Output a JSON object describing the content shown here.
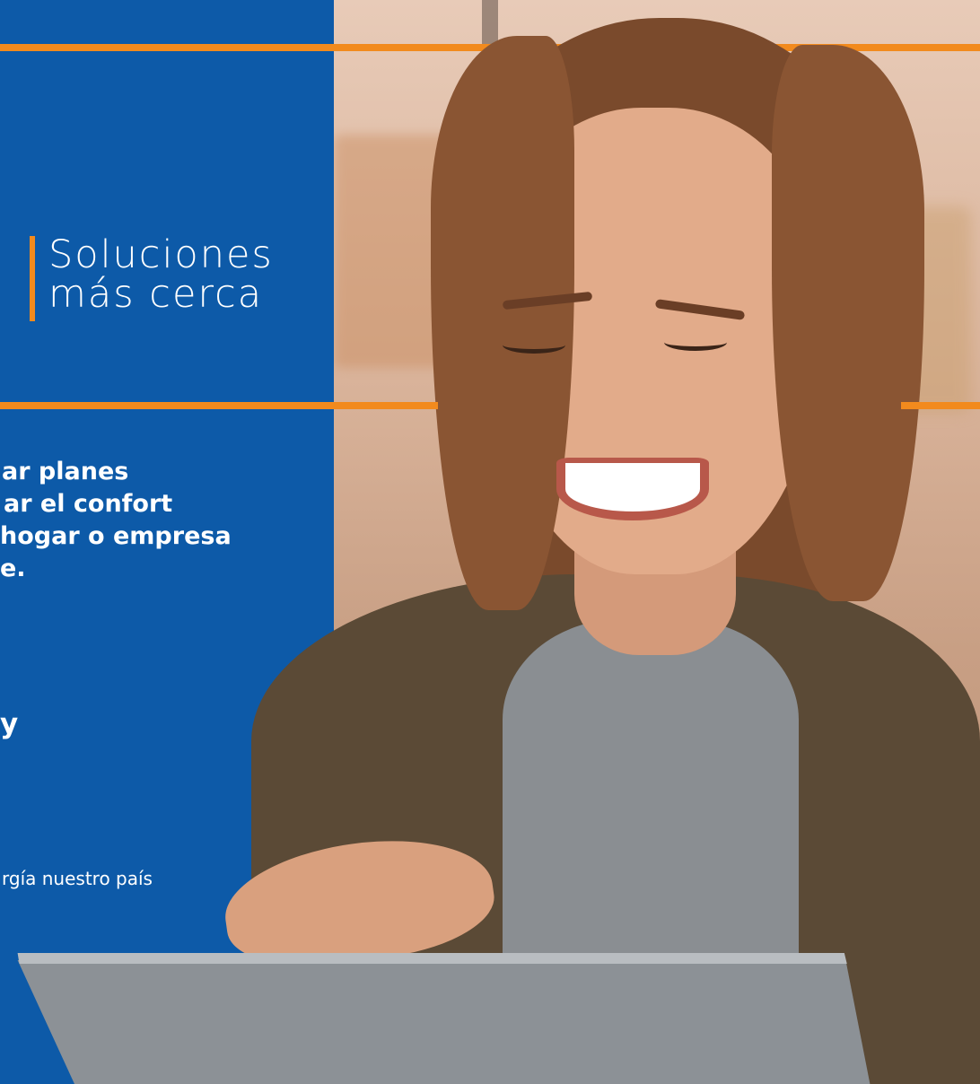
{
  "panel": {
    "background_color": "#0d5aa8",
    "accent_color": "#f28a1d"
  },
  "headline": {
    "line1": "Soluciones",
    "line2": "más cerca"
  },
  "body": {
    "line1": "ar planes",
    "line2": "ar el confort",
    "line3": "hogar o empresa",
    "line4": "e."
  },
  "bold_fragment": "y",
  "small_fragment": "rgía nuestro país",
  "photo": {
    "subject": "smiling-woman-using-tablet"
  }
}
